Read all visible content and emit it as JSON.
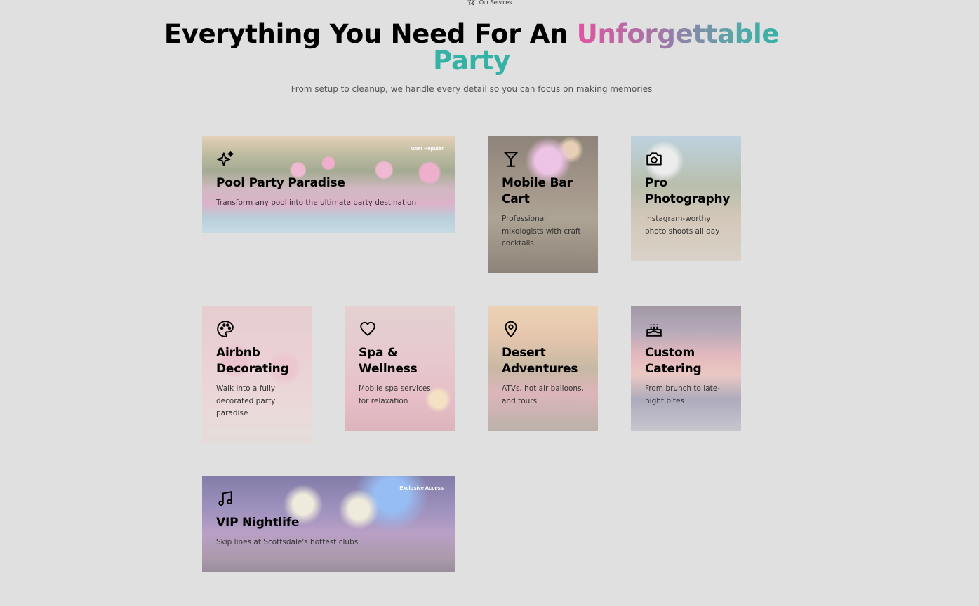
{
  "eyebrow": {
    "icon": "star-icon",
    "label": "Our Services"
  },
  "headline": {
    "part1": "Everything You Need For An ",
    "highlight": "Unforgettable",
    "highlight2": "Party"
  },
  "subtitle": "From setup to cleanup, we handle every detail so you can focus on making memories",
  "services": [
    {
      "icon": "sparkles-icon",
      "title": "Pool Party Paradise",
      "description": "Transform any pool into the ultimate party destination",
      "badge": "Most Popular"
    },
    {
      "icon": "martini-icon",
      "title": "Mobile Bar Cart",
      "description": "Professional mixologists with craft cocktails",
      "badge": ""
    },
    {
      "icon": "camera-icon",
      "title": "Pro Photography",
      "description": "Instagram-worthy photo shoots all day",
      "badge": ""
    },
    {
      "icon": "palette-icon",
      "title": "Airbnb Decorating",
      "description": "Walk into a fully decorated party paradise",
      "badge": ""
    },
    {
      "icon": "heart-icon",
      "title": "Spa & Wellness",
      "description": "Mobile spa services for relaxation",
      "badge": ""
    },
    {
      "icon": "map-pin-icon",
      "title": "Desert Adventures",
      "description": "ATVs, hot air balloons, and tours",
      "badge": ""
    },
    {
      "icon": "cake-icon",
      "title": "Custom Catering",
      "description": "From brunch to late-night bites",
      "badge": ""
    },
    {
      "icon": "music-icon",
      "title": "VIP Nightlife",
      "description": "Skip lines at Scottsdale's hottest clubs",
      "badge": "Exclusive Access"
    }
  ]
}
